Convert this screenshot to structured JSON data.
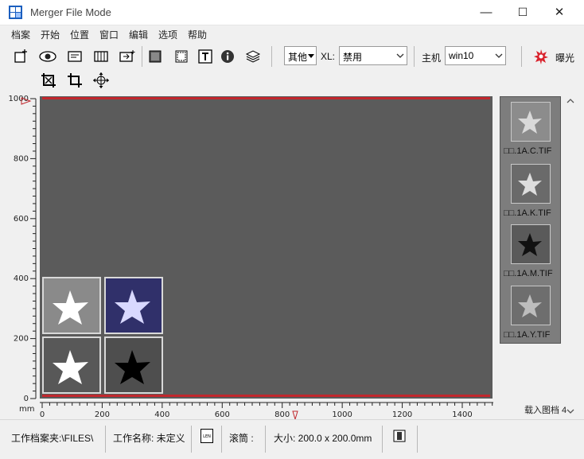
{
  "window": {
    "title": "Merger File Mode",
    "minimize": "—",
    "maximize": "☐",
    "close": "✕"
  },
  "menu": [
    "档案",
    "开始",
    "位置",
    "窗口",
    "编辑",
    "选项",
    "帮助"
  ],
  "toolbar": {
    "other_value": "其他",
    "xl_label": "XL:",
    "xl_value": "禁用",
    "host_label": "主机",
    "host_value": "win10",
    "exposure_label": "曝光"
  },
  "axes": {
    "unit": "mm",
    "y_ticks": [
      "1000",
      "800",
      "600",
      "400",
      "200",
      "0"
    ],
    "x_ticks": [
      "0",
      "200",
      "400",
      "600",
      "800",
      "1000",
      "1200",
      "1400"
    ]
  },
  "tiles": [
    {
      "name": "tile-c",
      "color": "#8a8a8a",
      "star": "#ffffff"
    },
    {
      "name": "tile-blue",
      "color": "#30306a",
      "star": "#d8d8ff"
    },
    {
      "name": "tile-k",
      "color": "#585858",
      "star": "#ffffff"
    },
    {
      "name": "tile-m",
      "color": "#4e4e4e",
      "star": "#000000"
    }
  ],
  "thumbnails": [
    {
      "label": "□□.1A.C.TIF",
      "bg": "#8c8c8c",
      "star": "#d9d9d9"
    },
    {
      "label": "□□.1A.K.TIF",
      "bg": "#6a6a6a",
      "star": "#dddddd"
    },
    {
      "label": "□□.1A.M.TIF",
      "bg": "#5a5a5a",
      "star": "#111111"
    },
    {
      "label": "□□.1A.Y.TIF",
      "bg": "#6e6e6e",
      "star": "#bdbdbd"
    }
  ],
  "load_status": "载入图档 4",
  "status": {
    "folder": "工作档案夹:\\FILES\\",
    "job_name": "工作名称: 未定义",
    "len_icon": "LEN",
    "scroll": "滚筒 :",
    "size": "大小: 200.0 x 200.0mm"
  },
  "colors": {
    "plot_bg": "#5b5b5b",
    "guide_line": "#c1272d",
    "accent": "#1b5fbf"
  }
}
